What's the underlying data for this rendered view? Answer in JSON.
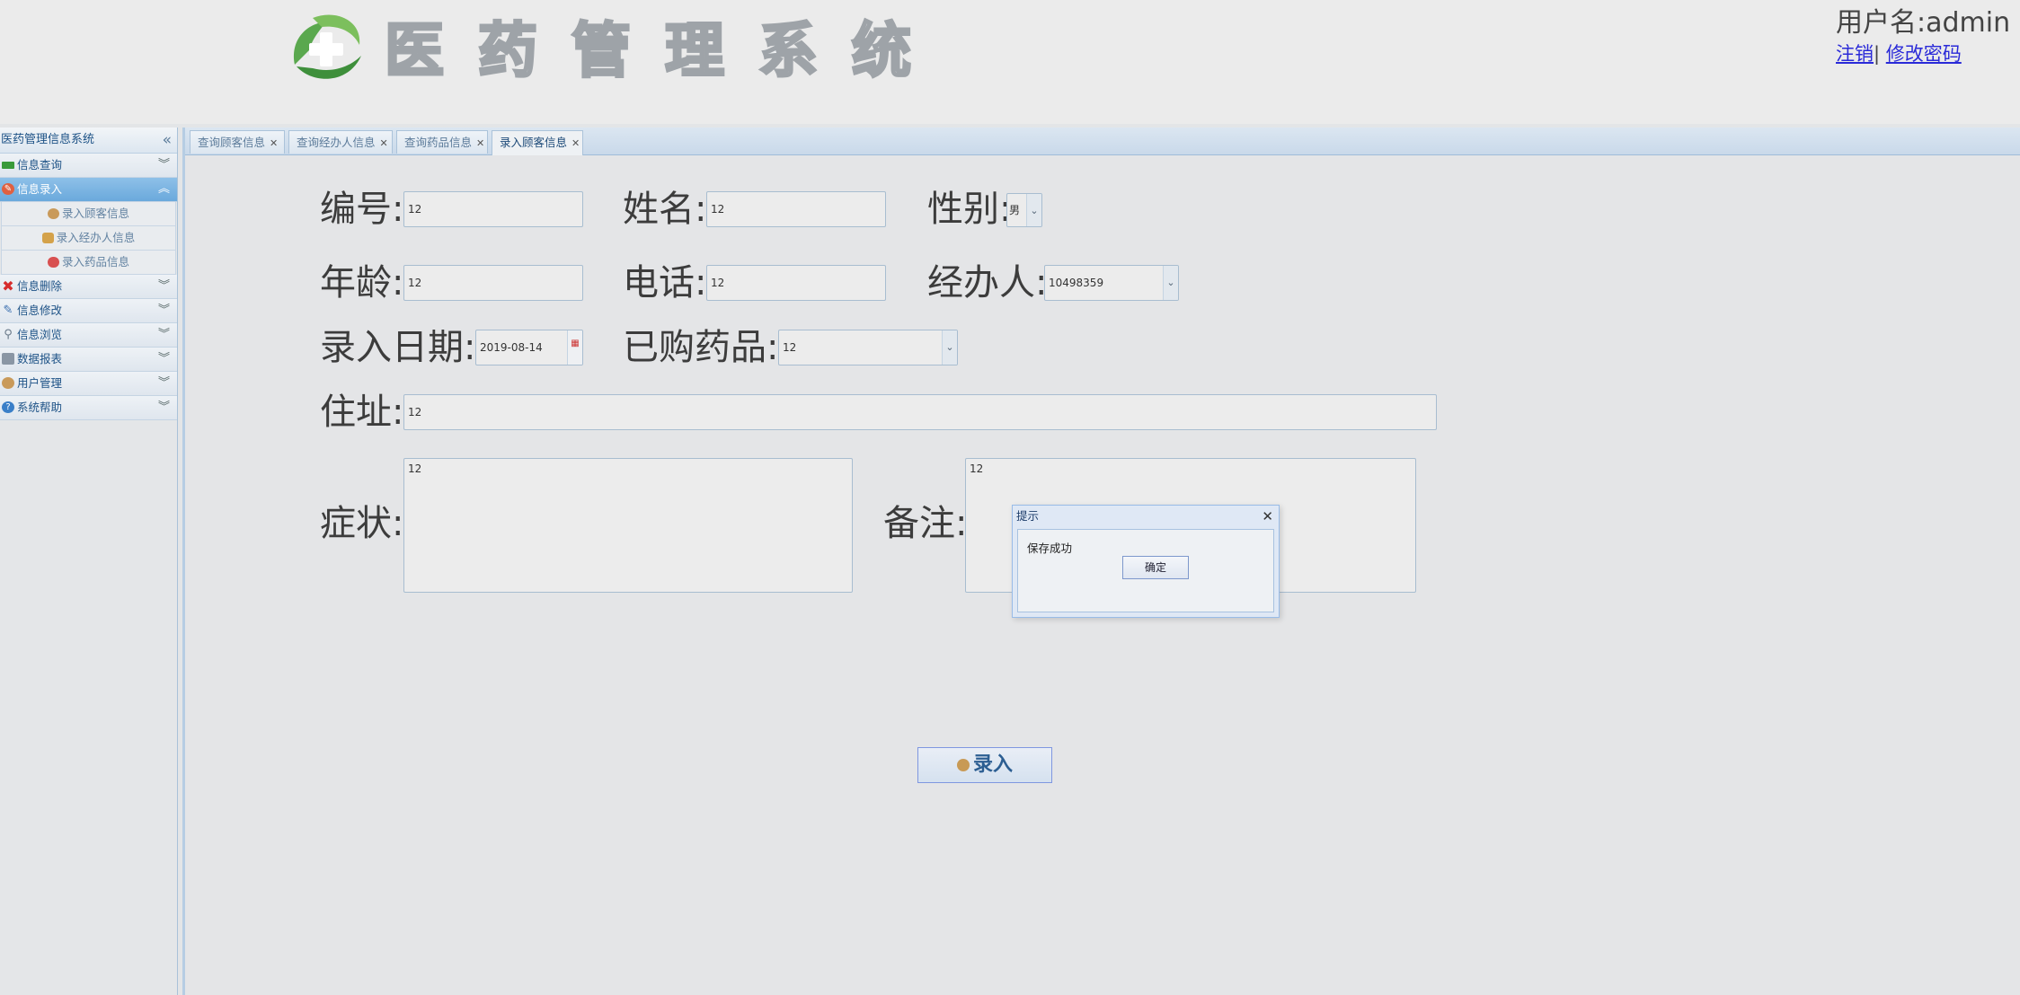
{
  "header": {
    "title": "医药管理系统",
    "user_label": "用户名:admin",
    "logout": "注销",
    "separator": "|",
    "change_password": "修改密码"
  },
  "sidebar": {
    "title": "医药管理信息系统",
    "collapse_glyph": "«",
    "menus": [
      {
        "label": "信息查询",
        "expanded": false
      },
      {
        "label": "信息录入",
        "expanded": true,
        "items": [
          "录入顾客信息",
          "录入经办人信息",
          "录入药品信息"
        ]
      },
      {
        "label": "信息删除",
        "expanded": false
      },
      {
        "label": "信息修改",
        "expanded": false
      },
      {
        "label": "信息浏览",
        "expanded": false
      },
      {
        "label": "数据报表",
        "expanded": false
      },
      {
        "label": "用户管理",
        "expanded": false
      },
      {
        "label": "系统帮助",
        "expanded": false
      }
    ]
  },
  "tabs": [
    {
      "label": "查询顾客信息",
      "active": false
    },
    {
      "label": "查询经办人信息",
      "active": false
    },
    {
      "label": "查询药品信息",
      "active": false
    },
    {
      "label": "录入顾客信息",
      "active": true
    }
  ],
  "form": {
    "id_label": "编号:",
    "id_value": "12",
    "name_label": "姓名:",
    "name_value": "12",
    "gender_label": "性别:",
    "gender_value": "男",
    "age_label": "年龄:",
    "age_value": "12",
    "phone_label": "电话:",
    "phone_value": "12",
    "agent_label": "经办人:",
    "agent_value": "10498359",
    "date_label": "录入日期:",
    "date_value": "2019-08-14",
    "drug_label": "已购药品:",
    "drug_value": "12",
    "address_label": "住址:",
    "address_value": "12",
    "symptom_label": "症状:",
    "symptom_value": "12",
    "remark_label": "备注:",
    "remark_value": "12",
    "submit_label": "录入"
  },
  "dialog": {
    "title": "提示",
    "message": "保存成功",
    "ok": "确定",
    "close_glyph": "✕"
  },
  "colors": {
    "accent": "#6aa9dc",
    "link": "#2a2ad8",
    "sidebar_text": "#1d5286"
  }
}
